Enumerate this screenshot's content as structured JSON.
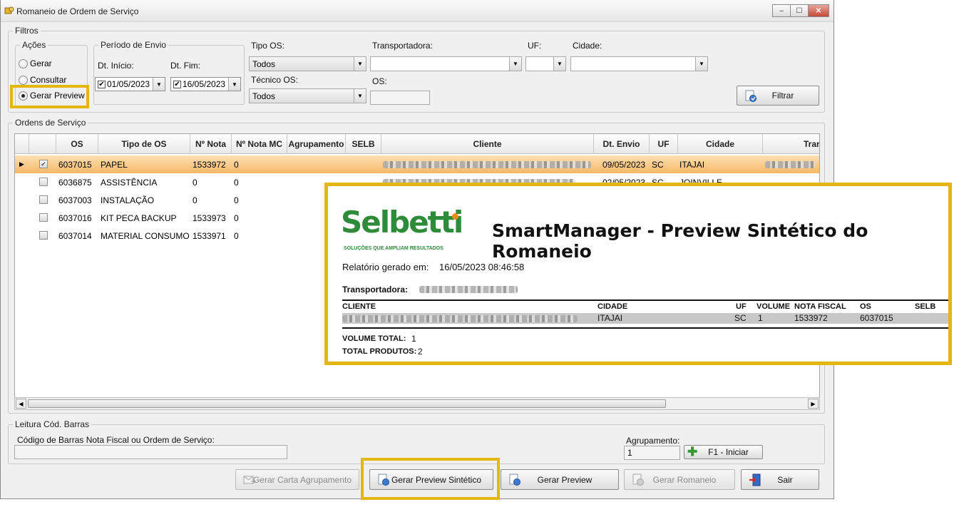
{
  "window": {
    "title": "Romaneio de Ordem de Serviço",
    "minimize_glyph": "–",
    "maximize_glyph": "☐",
    "close_glyph": "✕"
  },
  "filtros": {
    "label": "Filtros",
    "acoes": {
      "label": "Ações",
      "options": [
        "Gerar",
        "Consultar",
        "Gerar Preview"
      ],
      "selected": "Gerar Preview"
    },
    "periodo": {
      "label": "Período de Envio",
      "inicio_label": "Dt. Início:",
      "inicio_value": "01/05/2023",
      "fim_label": "Dt. Fim:",
      "fim_value": "16/05/2023"
    },
    "tipo_os": {
      "label": "Tipo OS:",
      "value": "Todos"
    },
    "tecnico_os": {
      "label": "Técnico OS:",
      "value": "Todos"
    },
    "transportadora": {
      "label": "Transportadora:",
      "value": ""
    },
    "uf": {
      "label": "UF:",
      "value": ""
    },
    "cidade": {
      "label": "Cidade:",
      "value": ""
    },
    "os": {
      "label": "OS:",
      "value": ""
    },
    "filtrar_label": "Filtrar"
  },
  "ordens": {
    "label": "Ordens de Serviço",
    "columns": [
      "OS",
      "Tipo de OS",
      "Nº Nota",
      "Nº Nota MC",
      "Agrupamento",
      "SELB",
      "Cliente",
      "Dt. Envio",
      "UF",
      "Cidade",
      "Trans"
    ],
    "rows": [
      {
        "os": "6037015",
        "tipo": "PAPEL",
        "nota": "1533972",
        "nota_mc": "0",
        "dt_envio": "09/05/2023",
        "uf": "SC",
        "cidade": "ITAJAI",
        "checked": true,
        "selected": true
      },
      {
        "os": "6036875",
        "tipo": "ASSISTÊNCIA",
        "nota": "0",
        "nota_mc": "0",
        "dt_envio": "02/05/2023",
        "uf": "SC",
        "cidade": "JOINVILLE",
        "checked": false,
        "selected": false
      },
      {
        "os": "6037003",
        "tipo": "INSTALAÇÃO",
        "nota": "0",
        "nota_mc": "0",
        "dt_envio": "",
        "uf": "",
        "cidade": "",
        "checked": false,
        "selected": false
      },
      {
        "os": "6037016",
        "tipo": "KIT PECA BACKUP",
        "nota": "1533973",
        "nota_mc": "0",
        "dt_envio": "",
        "uf": "",
        "cidade": "",
        "checked": false,
        "selected": false
      },
      {
        "os": "6037014",
        "tipo": "MATERIAL CONSUMO",
        "nota": "1533971",
        "nota_mc": "0",
        "dt_envio": "",
        "uf": "",
        "cidade": "",
        "checked": false,
        "selected": false
      }
    ]
  },
  "leitura": {
    "label": "Leitura Cód. Barras",
    "codigo_label": "Código de Barras Nota Fiscal ou Ordem de Serviço:",
    "codigo_value": "",
    "agrupamento_label": "Agrupamento:",
    "agrupamento_value": "1",
    "iniciar_label": "F1 - Iniciar"
  },
  "actions": {
    "carta": "Gerar Carta Agrupamento",
    "preview_sintetico": "Gerar Preview Sintético",
    "preview": "Gerar Preview",
    "romaneio": "Gerar Romaneio",
    "sair": "Sair"
  },
  "preview": {
    "logo_text": "Selbetti",
    "logo_tagline": "SOLUÇÕES QUE AMPLIAM RESULTADOS",
    "title": "SmartManager - Preview Sintético do Romaneio",
    "gerado_label": "Relatório gerado em:",
    "gerado_value": "16/05/2023 08:46:58",
    "transportadora_label": "Transportadora:",
    "headers": [
      "CLIENTE",
      "CIDADE",
      "UF",
      "VOLUME",
      "NOTA FISCAL",
      "OS",
      "SELB"
    ],
    "row": {
      "cidade": "ITAJAI",
      "uf": "SC",
      "volume": "1",
      "nota": "1533972",
      "os": "6037015"
    },
    "volume_total_label": "VOLUME TOTAL:",
    "volume_total_value": "1",
    "total_produtos_label": "TOTAL PRODUTOS:",
    "total_produtos_value": "2"
  },
  "colors": {
    "highlight": "#e3b70f",
    "selected_row": "#f6b866",
    "logo_green": "#2e8b3a",
    "logo_orange": "#f08a1c"
  }
}
